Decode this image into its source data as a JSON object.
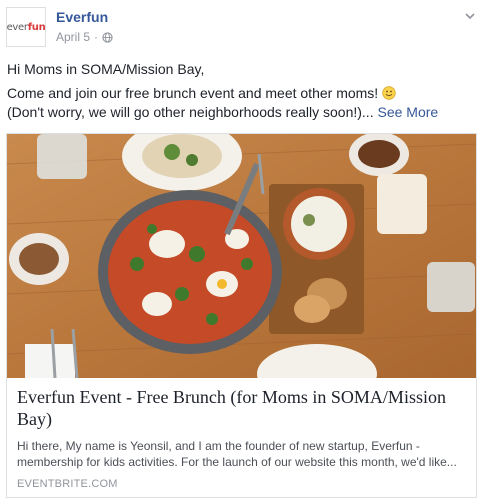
{
  "post": {
    "page_name": "Everfun",
    "date": "April 5",
    "separator": "·",
    "avatar_logo": {
      "prefix": "ever",
      "suffix": "fun"
    },
    "text": {
      "line1": "Hi Moms in SOMA/Mission Bay,",
      "line2": "Come and join our free brunch event and meet other moms!",
      "line3": "(Don't worry, we will go other neighborhoods really soon!)...",
      "see_more": "See More"
    }
  },
  "attachment": {
    "title": "Everfun Event - Free Brunch (for Moms in SOMA/Mission Bay)",
    "description": "Hi there, My name is Yeonsil, and I am the founder of new startup, Everfun - membership for kids activities. For the launch of our website this month, we'd like...",
    "domain": "EVENTBRITE.COM"
  },
  "icons": {
    "audience": "globe-icon",
    "menu": "chevron-down-icon",
    "emoji": "smiley-emoji-icon"
  },
  "colors": {
    "link": "#365899",
    "meta": "#90949c",
    "text": "#1d2129",
    "border": "#dddfe2"
  }
}
